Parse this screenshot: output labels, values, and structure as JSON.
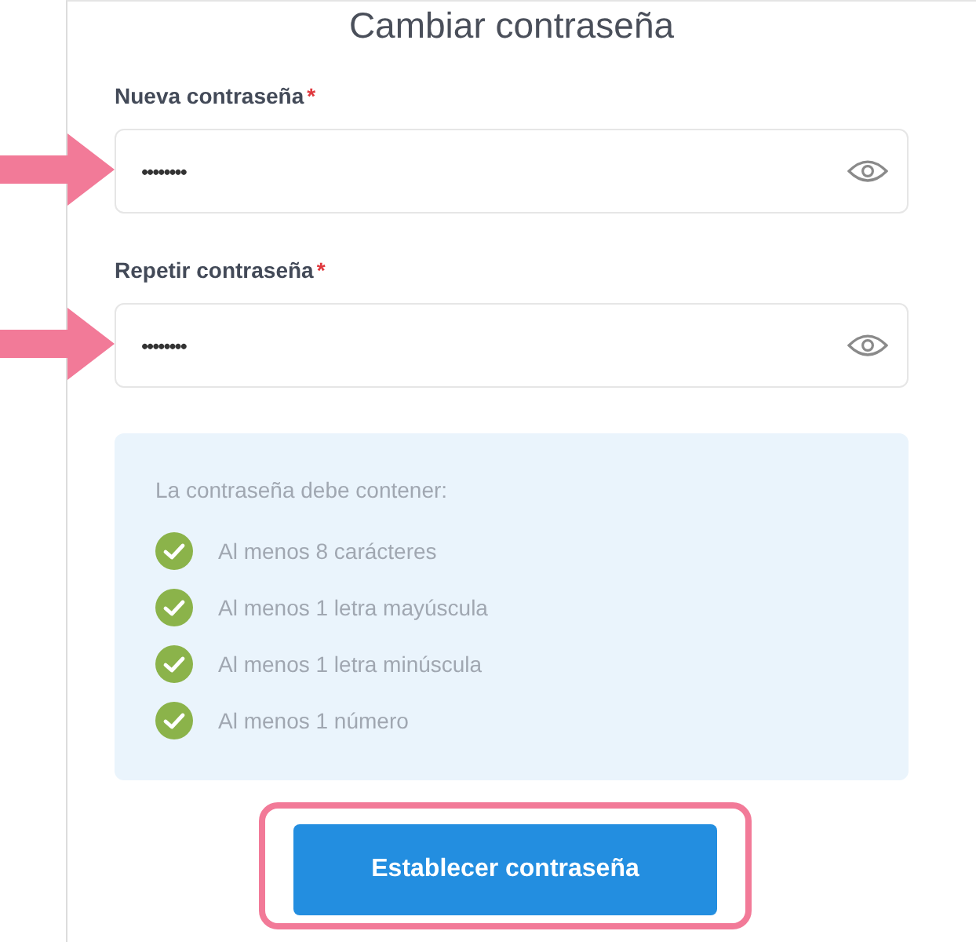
{
  "title": "Cambiar contraseña",
  "fields": [
    {
      "label": "Nueva contraseña",
      "required_mark": "*",
      "value": "••••••••",
      "highlighted": true
    },
    {
      "label": "Repetir contraseña",
      "required_mark": "*",
      "value": "••••••••",
      "highlighted": true
    }
  ],
  "requirements": {
    "heading": "La contraseña debe contener:",
    "items": [
      {
        "text": "Al menos 8 carácteres",
        "met": true
      },
      {
        "text": "Al menos 1 letra mayúscula",
        "met": true
      },
      {
        "text": "Al menos 1 letra minúscula",
        "met": true
      },
      {
        "text": "Al menos 1 número",
        "met": true
      }
    ]
  },
  "submit": {
    "label": "Establecer contraseña",
    "highlighted": true
  }
}
